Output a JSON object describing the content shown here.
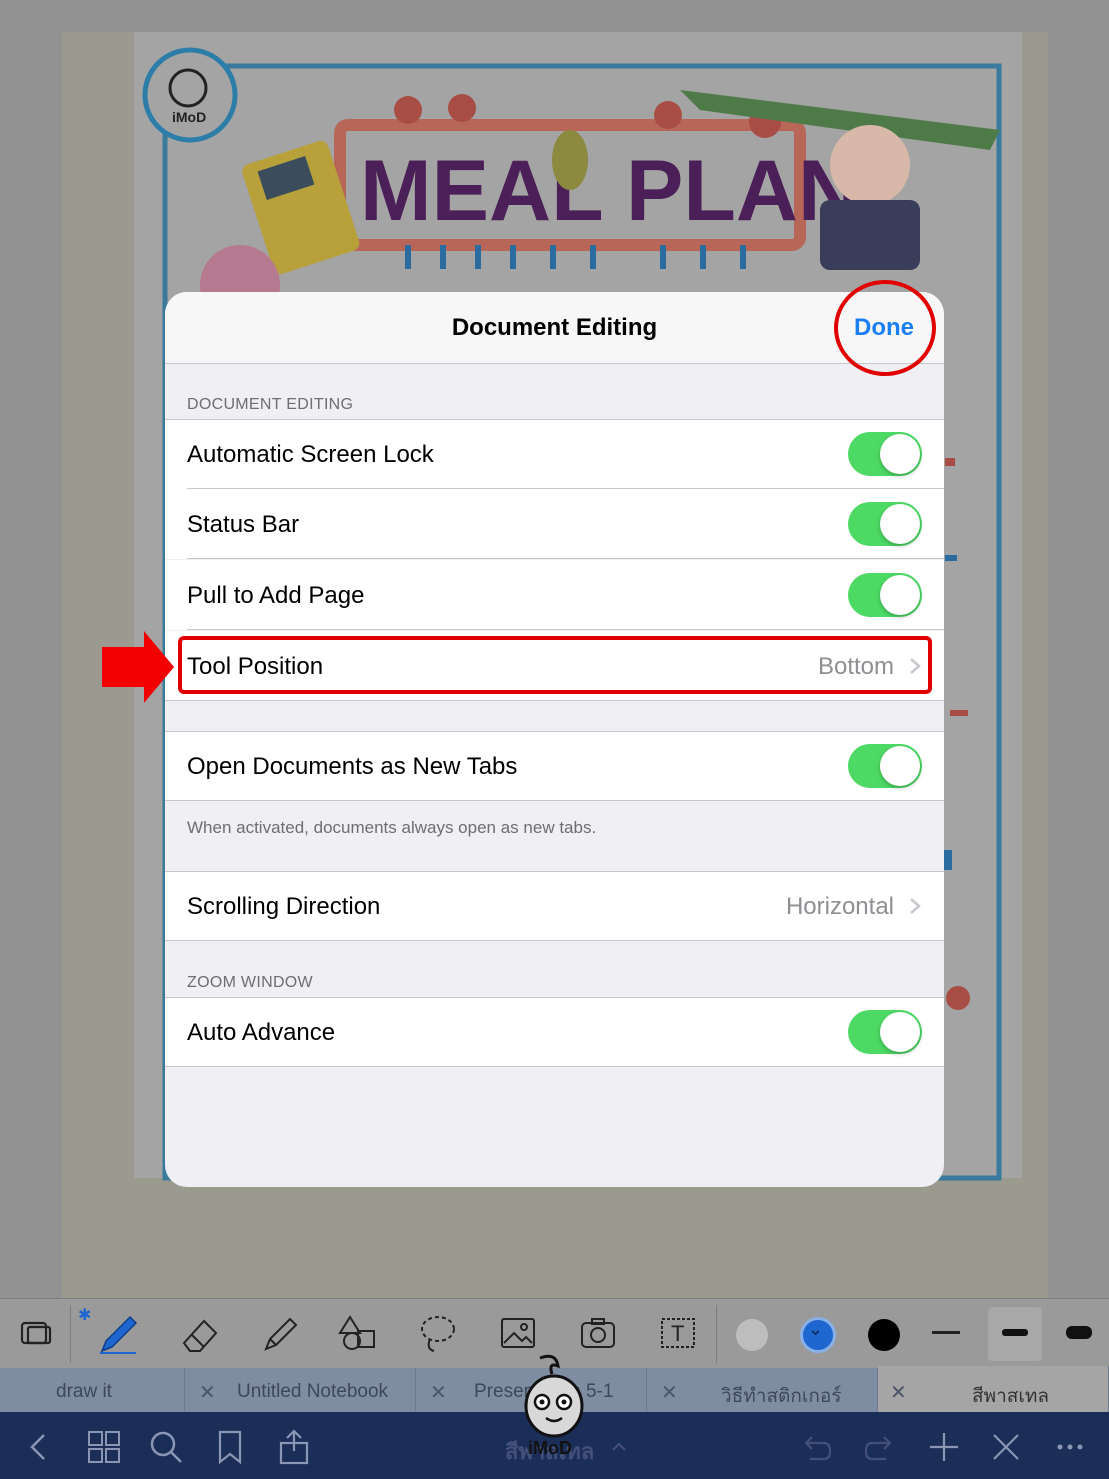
{
  "background": {
    "poster_title": "MEAL PLAN",
    "logo_text": "iMoD"
  },
  "modal": {
    "title": "Document Editing",
    "done_label": "Done",
    "section_document_editing": "DOCUMENT EDITING",
    "rows": {
      "auto_lock": {
        "label": "Automatic Screen Lock",
        "on": true
      },
      "status_bar": {
        "label": "Status Bar",
        "on": true
      },
      "pull_add": {
        "label": "Pull to Add Page",
        "on": true
      },
      "tool_position": {
        "label": "Tool Position",
        "value": "Bottom"
      },
      "open_tabs": {
        "label": "Open Documents as New Tabs",
        "on": true
      },
      "scrolling": {
        "label": "Scrolling Direction",
        "value": "Horizontal"
      },
      "auto_advance": {
        "label": "Auto Advance",
        "on": true
      }
    },
    "open_tabs_footnote": "When activated, documents always open as new tabs.",
    "section_zoom_window": "ZOOM WINDOW"
  },
  "toolbar": {
    "tools": [
      "page-layout-icon",
      "pen-icon",
      "eraser-icon",
      "highlighter-icon",
      "shapes-icon",
      "lasso-icon",
      "image-icon",
      "camera-icon",
      "text-icon"
    ],
    "colors": [
      "#bdbdbd",
      "#1e66d0",
      "#000000"
    ]
  },
  "tabs": [
    {
      "label": "draw it"
    },
    {
      "label": "Untitled Notebook"
    },
    {
      "label": "Presentation 5-1"
    },
    {
      "label": "วิธีทำสติกเกอร์"
    },
    {
      "label": "สีพาสเทล"
    }
  ],
  "navbar": {
    "title": "สีพาสเทล"
  },
  "colors": {
    "accent": "#1a7ef5",
    "toggle_on": "#4cd964",
    "annotation": "#e00000"
  }
}
